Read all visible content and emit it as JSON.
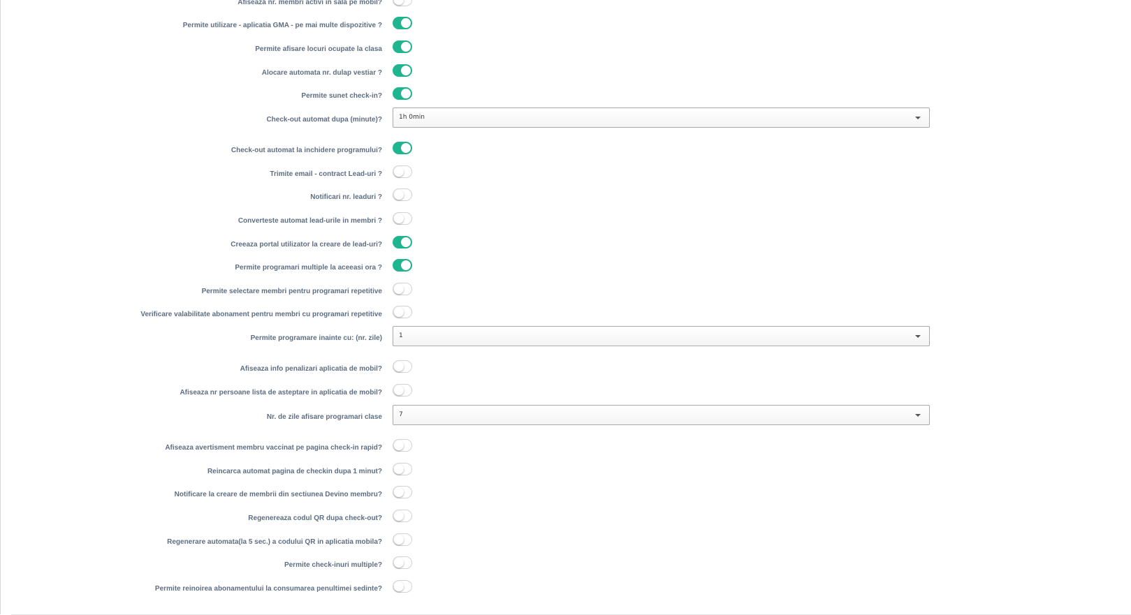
{
  "colors": {
    "toggle_on": "#1fb58f",
    "label": "#5e6e82"
  },
  "settings": [
    {
      "label": "Afiseaza nr. membri activi in sala pe mobil?",
      "type": "toggle",
      "on": false
    },
    {
      "label": "Permite utilizare - aplicatia GMA - pe mai multe dispozitive ?",
      "type": "toggle",
      "on": true
    },
    {
      "label": "Permite afisare locuri ocupate la clasa",
      "type": "toggle",
      "on": true
    },
    {
      "label": "Alocare automata nr. dulap vestiar ?",
      "type": "toggle",
      "on": true
    },
    {
      "label": "Permite sunet check-in?",
      "type": "toggle",
      "on": true
    },
    {
      "label": "Check-out automat dupa (minute)?",
      "type": "select",
      "value": "1h 0min"
    },
    {
      "label": "Check-out automat la inchidere programului?",
      "type": "toggle",
      "on": true
    },
    {
      "label": "Trimite email - contract Lead-uri ?",
      "type": "toggle",
      "on": false
    },
    {
      "label": "Notificari nr. leaduri ?",
      "type": "toggle",
      "on": false
    },
    {
      "label": "Converteste automat lead-urile in membri ?",
      "type": "toggle",
      "on": false
    },
    {
      "label": "Creeaza portal utilizator la creare de lead-uri?",
      "type": "toggle",
      "on": true
    },
    {
      "label": "Permite programari multiple la aceeasi ora ?",
      "type": "toggle",
      "on": true
    },
    {
      "label": "Permite selectare membri pentru programari repetitive",
      "type": "toggle",
      "on": false
    },
    {
      "label": "Verificare valabilitate abonament pentru membri cu programari repetitive",
      "type": "toggle",
      "on": false
    },
    {
      "label": "Permite programare inainte cu: (nr. zile)",
      "type": "select",
      "value": "1"
    },
    {
      "label": "Afiseaza info penalizari aplicatia de mobil?",
      "type": "toggle",
      "on": false
    },
    {
      "label": "Afiseaza nr persoane lista de asteptare in aplicatia de mobil?",
      "type": "toggle",
      "on": false
    },
    {
      "label": "Nr. de zile afisare programari clase",
      "type": "select",
      "value": "7"
    },
    {
      "label": "Afiseaza avertisment membru vaccinat pe pagina check-in rapid?",
      "type": "toggle",
      "on": false
    },
    {
      "label": "Reincarca automat pagina de checkin dupa 1 minut?",
      "type": "toggle",
      "on": false
    },
    {
      "label": "Notificare la creare de membrii din sectiunea Devino membru?",
      "type": "toggle",
      "on": false
    },
    {
      "label": "Regenereaza codul QR dupa check-out?",
      "type": "toggle",
      "on": false
    },
    {
      "label": "Regenerare automata(la 5 sec.) a codului QR in aplicatia mobila?",
      "type": "toggle",
      "on": false
    },
    {
      "label": "Permite check-inuri multiple?",
      "type": "toggle",
      "on": false
    },
    {
      "label": "Permite reinoirea abonamentului la consumarea penultimei sedinte?",
      "type": "toggle",
      "on": false
    }
  ]
}
